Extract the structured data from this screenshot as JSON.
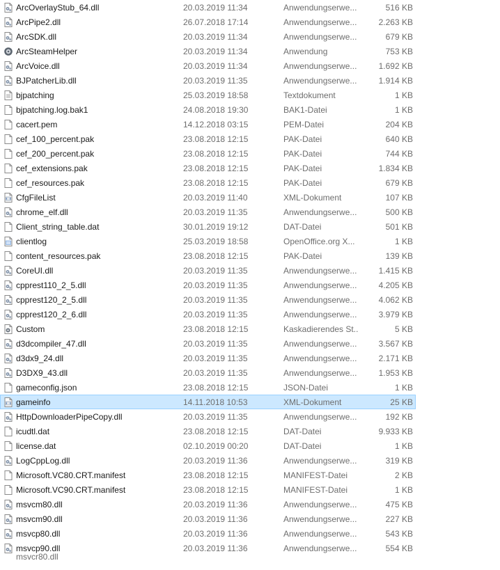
{
  "files": [
    {
      "name": "ArcOverlayStub_64.dll",
      "date": "20.03.2019 11:34",
      "type": "Anwendungserwe...",
      "size": "516 KB",
      "icon": "dll-icon"
    },
    {
      "name": "ArcPipe2.dll",
      "date": "26.07.2018 17:14",
      "type": "Anwendungserwe...",
      "size": "2.263 KB",
      "icon": "dll-icon"
    },
    {
      "name": "ArcSDK.dll",
      "date": "20.03.2019 11:34",
      "type": "Anwendungserwe...",
      "size": "679 KB",
      "icon": "dll-icon"
    },
    {
      "name": "ArcSteamHelper",
      "date": "20.03.2019 11:34",
      "type": "Anwendung",
      "size": "753 KB",
      "icon": "exe-gear-icon"
    },
    {
      "name": "ArcVoice.dll",
      "date": "20.03.2019 11:34",
      "type": "Anwendungserwe...",
      "size": "1.692 KB",
      "icon": "dll-icon"
    },
    {
      "name": "BJPatcherLib.dll",
      "date": "20.03.2019 11:35",
      "type": "Anwendungserwe...",
      "size": "1.914 KB",
      "icon": "dll-icon"
    },
    {
      "name": "bjpatching",
      "date": "25.03.2019 18:58",
      "type": "Textdokument",
      "size": "1 KB",
      "icon": "text-file-icon"
    },
    {
      "name": "bjpatching.log.bak1",
      "date": "24.08.2018 19:30",
      "type": "BAK1-Datei",
      "size": "1 KB",
      "icon": "file-icon"
    },
    {
      "name": "cacert.pem",
      "date": "14.12.2018 03:15",
      "type": "PEM-Datei",
      "size": "204 KB",
      "icon": "file-icon"
    },
    {
      "name": "cef_100_percent.pak",
      "date": "23.08.2018 12:15",
      "type": "PAK-Datei",
      "size": "640 KB",
      "icon": "file-icon"
    },
    {
      "name": "cef_200_percent.pak",
      "date": "23.08.2018 12:15",
      "type": "PAK-Datei",
      "size": "744 KB",
      "icon": "file-icon"
    },
    {
      "name": "cef_extensions.pak",
      "date": "23.08.2018 12:15",
      "type": "PAK-Datei",
      "size": "1.834 KB",
      "icon": "file-icon"
    },
    {
      "name": "cef_resources.pak",
      "date": "23.08.2018 12:15",
      "type": "PAK-Datei",
      "size": "679 KB",
      "icon": "file-icon"
    },
    {
      "name": "CfgFileList",
      "date": "20.03.2019 11:40",
      "type": "XML-Dokument",
      "size": "107 KB",
      "icon": "xml-file-icon"
    },
    {
      "name": "chrome_elf.dll",
      "date": "20.03.2019 11:35",
      "type": "Anwendungserwe...",
      "size": "500 KB",
      "icon": "dll-icon"
    },
    {
      "name": "Client_string_table.dat",
      "date": "30.01.2019 19:12",
      "type": "DAT-Datei",
      "size": "501 KB",
      "icon": "file-icon"
    },
    {
      "name": "clientlog",
      "date": "25.03.2019 18:58",
      "type": "OpenOffice.org X...",
      "size": "1 KB",
      "icon": "openoffice-file-icon"
    },
    {
      "name": "content_resources.pak",
      "date": "23.08.2018 12:15",
      "type": "PAK-Datei",
      "size": "139 KB",
      "icon": "file-icon"
    },
    {
      "name": "CoreUI.dll",
      "date": "20.03.2019 11:35",
      "type": "Anwendungserwe...",
      "size": "1.415 KB",
      "icon": "dll-icon"
    },
    {
      "name": "cpprest110_2_5.dll",
      "date": "20.03.2019 11:35",
      "type": "Anwendungserwe...",
      "size": "4.205 KB",
      "icon": "dll-icon"
    },
    {
      "name": "cpprest120_2_5.dll",
      "date": "20.03.2019 11:35",
      "type": "Anwendungserwe...",
      "size": "4.062 KB",
      "icon": "dll-icon"
    },
    {
      "name": "cpprest120_2_6.dll",
      "date": "20.03.2019 11:35",
      "type": "Anwendungserwe...",
      "size": "3.979 KB",
      "icon": "dll-icon"
    },
    {
      "name": "Custom",
      "date": "23.08.2018 12:15",
      "type": "Kaskadierendes St...",
      "size": "5 KB",
      "icon": "css-gear-icon"
    },
    {
      "name": "d3dcompiler_47.dll",
      "date": "20.03.2019 11:35",
      "type": "Anwendungserwe...",
      "size": "3.567 KB",
      "icon": "dll-icon"
    },
    {
      "name": "d3dx9_24.dll",
      "date": "20.03.2019 11:35",
      "type": "Anwendungserwe...",
      "size": "2.171 KB",
      "icon": "dll-icon"
    },
    {
      "name": "D3DX9_43.dll",
      "date": "20.03.2019 11:35",
      "type": "Anwendungserwe...",
      "size": "1.953 KB",
      "icon": "dll-icon"
    },
    {
      "name": "gameconfig.json",
      "date": "23.08.2018 12:15",
      "type": "JSON-Datei",
      "size": "1 KB",
      "icon": "file-icon"
    },
    {
      "name": "gameinfo",
      "date": "14.11.2018 10:53",
      "type": "XML-Dokument",
      "size": "25 KB",
      "icon": "xml-file-icon",
      "selected": true
    },
    {
      "name": "HttpDownloaderPipeCopy.dll",
      "date": "20.03.2019 11:35",
      "type": "Anwendungserwe...",
      "size": "192 KB",
      "icon": "dll-icon"
    },
    {
      "name": "icudtl.dat",
      "date": "23.08.2018 12:15",
      "type": "DAT-Datei",
      "size": "9.933 KB",
      "icon": "file-icon"
    },
    {
      "name": "license.dat",
      "date": "02.10.2019 00:20",
      "type": "DAT-Datei",
      "size": "1 KB",
      "icon": "file-icon"
    },
    {
      "name": "LogCppLog.dll",
      "date": "20.03.2019 11:36",
      "type": "Anwendungserwe...",
      "size": "319 KB",
      "icon": "dll-icon"
    },
    {
      "name": "Microsoft.VC80.CRT.manifest",
      "date": "23.08.2018 12:15",
      "type": "MANIFEST-Datei",
      "size": "2 KB",
      "icon": "file-icon"
    },
    {
      "name": "Microsoft.VC90.CRT.manifest",
      "date": "23.08.2018 12:15",
      "type": "MANIFEST-Datei",
      "size": "1 KB",
      "icon": "file-icon"
    },
    {
      "name": "msvcm80.dll",
      "date": "20.03.2019 11:36",
      "type": "Anwendungserwe...",
      "size": "475 KB",
      "icon": "dll-icon"
    },
    {
      "name": "msvcm90.dll",
      "date": "20.03.2019 11:36",
      "type": "Anwendungserwe...",
      "size": "227 KB",
      "icon": "dll-icon"
    },
    {
      "name": "msvcp80.dll",
      "date": "20.03.2019 11:36",
      "type": "Anwendungserwe...",
      "size": "543 KB",
      "icon": "dll-icon"
    },
    {
      "name": "msvcp90.dll",
      "date": "20.03.2019 11:36",
      "type": "Anwendungserwe...",
      "size": "554 KB",
      "icon": "dll-icon"
    }
  ],
  "truncated_next_row": "msvcr80.dll"
}
